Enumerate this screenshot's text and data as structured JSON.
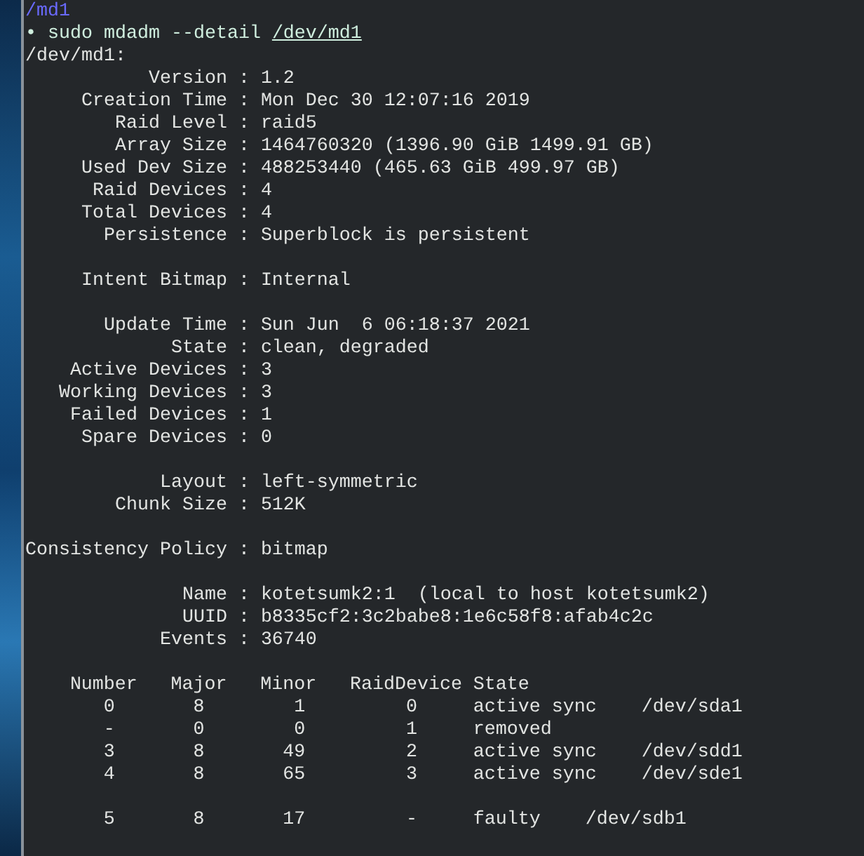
{
  "terminal": {
    "cwd": "/md1",
    "prompt": {
      "marker": "•",
      "command": "sudo mdadm --detail",
      "argument": "/dev/md1"
    },
    "device": "/dev/md1:",
    "separator": ":",
    "field_groups": [
      [
        {
          "label": "Version",
          "value": "1.2"
        },
        {
          "label": "Creation Time",
          "value": "Mon Dec 30 12:07:16 2019"
        },
        {
          "label": "Raid Level",
          "value": "raid5"
        },
        {
          "label": "Array Size",
          "value": "1464760320 (1396.90 GiB 1499.91 GB)"
        },
        {
          "label": "Used Dev Size",
          "value": "488253440 (465.63 GiB 499.97 GB)"
        },
        {
          "label": "Raid Devices",
          "value": "4"
        },
        {
          "label": "Total Devices",
          "value": "4"
        },
        {
          "label": "Persistence",
          "value": "Superblock is persistent"
        }
      ],
      [
        {
          "label": "Intent Bitmap",
          "value": "Internal"
        }
      ],
      [
        {
          "label": "Update Time",
          "value": "Sun Jun  6 06:18:37 2021"
        },
        {
          "label": "State",
          "value": "clean, degraded"
        },
        {
          "label": "Active Devices",
          "value": "3"
        },
        {
          "label": "Working Devices",
          "value": "3"
        },
        {
          "label": "Failed Devices",
          "value": "1"
        },
        {
          "label": "Spare Devices",
          "value": "0"
        }
      ],
      [
        {
          "label": "Layout",
          "value": "left-symmetric"
        },
        {
          "label": "Chunk Size",
          "value": "512K"
        }
      ],
      [
        {
          "label": "Consistency Policy",
          "value": "bitmap"
        }
      ],
      [
        {
          "label": "Name",
          "value": "kotetsumk2:1  (local to host kotetsumk2)"
        },
        {
          "label": "UUID",
          "value": "b8335cf2:3c2babe8:1e6c58f8:afab4c2c"
        },
        {
          "label": "Events",
          "value": "36740"
        }
      ]
    ],
    "table": {
      "columns": [
        "Number",
        "Major",
        "Minor",
        "RaidDevice",
        "State"
      ],
      "row_groups": [
        [
          {
            "number": "0",
            "major": "8",
            "minor": "1",
            "raid_device": "0",
            "state": "active sync",
            "device": "/dev/sda1"
          },
          {
            "number": "-",
            "major": "0",
            "minor": "0",
            "raid_device": "1",
            "state": "removed"
          },
          {
            "number": "3",
            "major": "8",
            "minor": "49",
            "raid_device": "2",
            "state": "active sync",
            "device": "/dev/sdd1"
          },
          {
            "number": "4",
            "major": "8",
            "minor": "65",
            "raid_device": "3",
            "state": "active sync",
            "device": "/dev/sde1"
          }
        ],
        [
          {
            "number": "5",
            "major": "8",
            "minor": "17",
            "raid_device": "-",
            "state": "faulty",
            "device": "/dev/sdb1"
          }
        ]
      ]
    }
  }
}
